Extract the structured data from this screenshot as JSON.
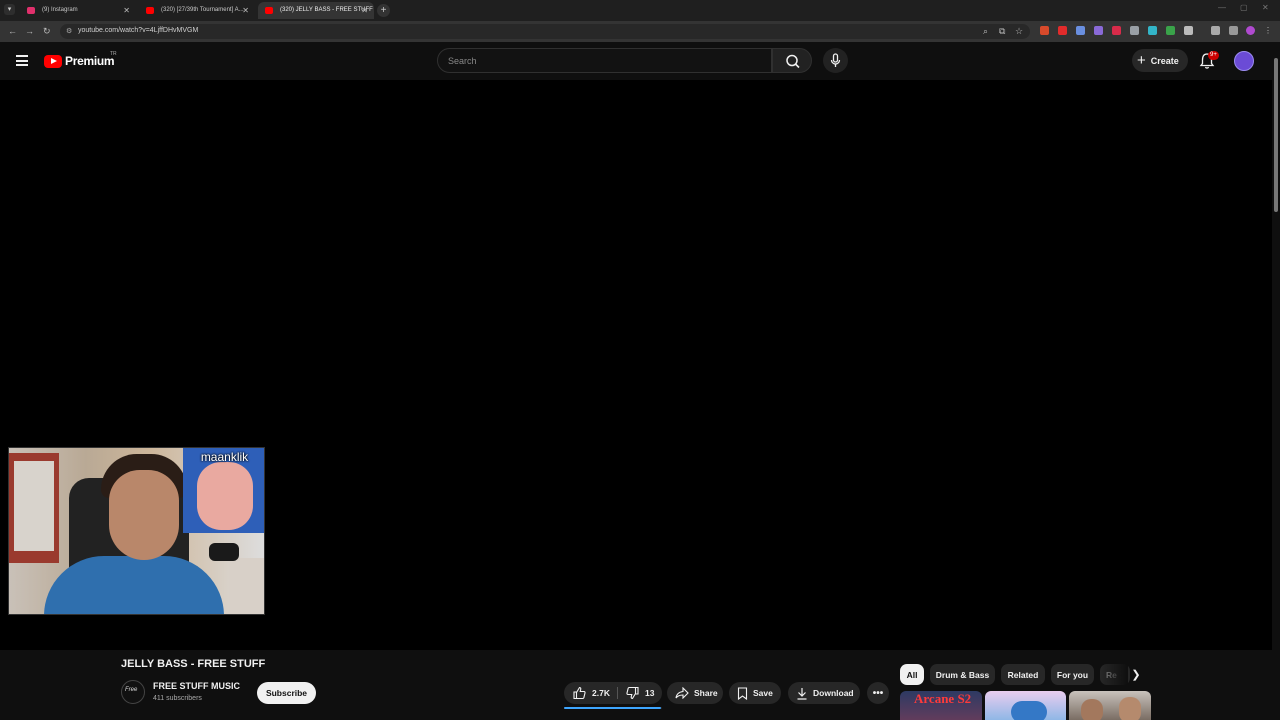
{
  "browser": {
    "tabs": [
      {
        "title": "(9) Instagram",
        "fav_color": "#e1306c",
        "active": false
      },
      {
        "title": "(320) [27/39th Tournament] A...",
        "fav_color": "#ff0000",
        "active": false
      },
      {
        "title": "(320) JELLY BASS - FREE STUFF",
        "fav_color": "#ff0000",
        "active": true
      }
    ],
    "url": "youtube.com/watch?v=4LjffDHvMVGM"
  },
  "header": {
    "logo_text": "Premium",
    "logo_country": "TR",
    "search_placeholder": "Search",
    "create_label": "Create",
    "notifications_badge": "9+"
  },
  "webcam": {
    "inset_label": "maanklik"
  },
  "video": {
    "title": "JELLY BASS - FREE STUFF",
    "channel_name": "FREE STUFF MUSIC",
    "channel_avatar_text": "Free",
    "subscribers": "411 subscribers",
    "subscribe_label": "Subscribe",
    "likes": "2.7K",
    "like_ratio": 0.99,
    "dislikes": "13",
    "share_label": "Share",
    "save_label": "Save",
    "download_label": "Download",
    "more_label": "•••"
  },
  "chips": {
    "items": [
      "All",
      "Drum & Bass",
      "Related",
      "For you",
      "Re"
    ],
    "selected": "All"
  },
  "recommendations": {
    "thumb1_text": "Arcane S2"
  },
  "colors": {
    "background": "#0f0f0f",
    "brand_red": "#ff0000",
    "like_bar": "#3ea6ff",
    "chip_bg": "#272727"
  }
}
